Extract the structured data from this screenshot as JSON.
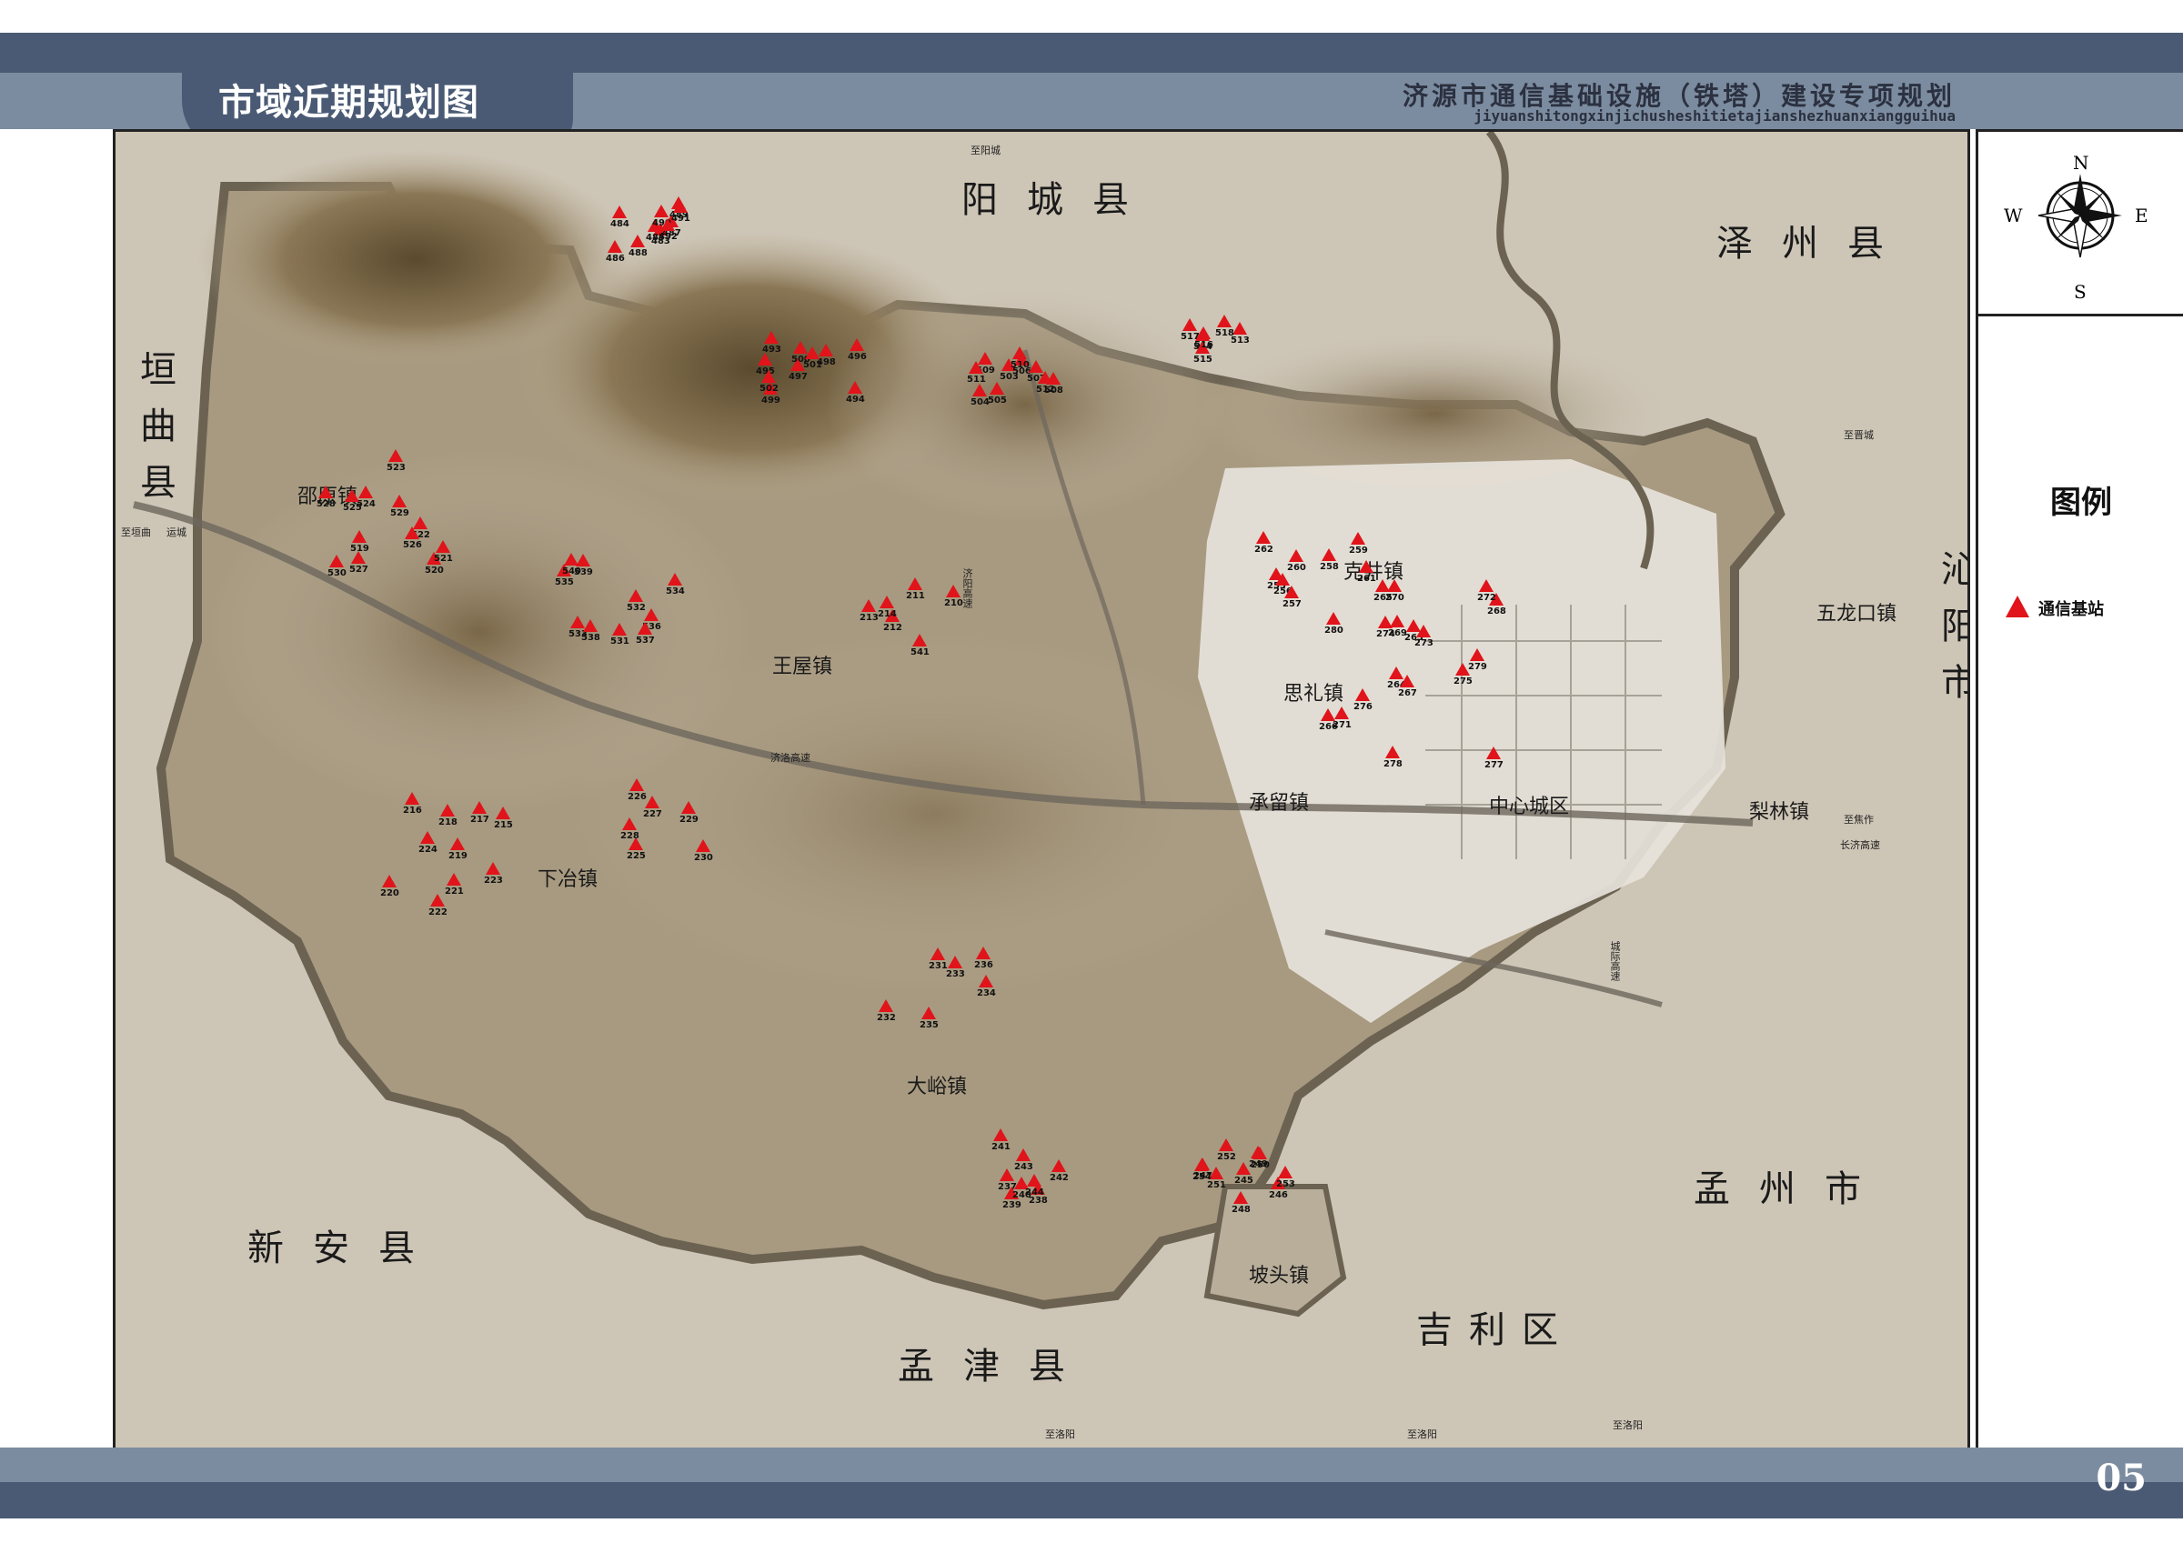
{
  "header": {
    "title": "市域近期规划图",
    "project_title": "济源市通信基础设施（铁塔）建设专项规划",
    "project_pinyin": "jiyuanshitongxinjichusheshitietajianshezhuanxiangguihua"
  },
  "footer": {
    "page_number": "05"
  },
  "compass": {
    "n": "N",
    "s": "S",
    "e": "E",
    "w": "W"
  },
  "legend": {
    "title": "图例",
    "items": [
      {
        "label": "通信基站",
        "color": "#e0141a",
        "icon": "red-triangle-icon"
      }
    ]
  },
  "map": {
    "neighbors": {
      "yangcheng": "阳城县",
      "zezhou": "泽州县",
      "yuanqu": "垣曲县",
      "qinyang": "沁阳市",
      "xinan": "新安县",
      "mengjin": "孟津县",
      "mengzhou": "孟州市",
      "jili": "吉利区"
    },
    "towns": {
      "shaoyuan": "邵原镇",
      "wangwu": "王屋镇",
      "xiaye": "下冶镇",
      "dayu": "大峪镇",
      "potou": "坡头镇",
      "kejing": "克井镇",
      "sili": "思礼镇",
      "chengliu": "承留镇",
      "center": "中心城区",
      "wulongkou": "五龙口镇",
      "liling": "梨林镇"
    },
    "roads": {
      "to_yangcheng": "至阳城",
      "to_yuncheng": "至垣曲",
      "yuncheng": "运城",
      "jiyang_highway": "济阳高速",
      "jiluo_highway": "济洛高速",
      "to_jincheng": "至晋城",
      "to_jiaozuo": "至焦作",
      "changji_highway": "长济高速",
      "to_luoyang_1": "至洛阳",
      "to_luoyang_2": "至洛阳",
      "to_luoyang_3": "至洛阳",
      "chengji_highway": "城际高速"
    },
    "stations": [
      "483",
      "484",
      "485",
      "486",
      "487",
      "488",
      "489",
      "490",
      "491",
      "492",
      "493",
      "494",
      "495",
      "496",
      "497",
      "498",
      "499",
      "500",
      "501",
      "502",
      "503",
      "504",
      "505",
      "506",
      "507",
      "508",
      "509",
      "510",
      "511",
      "512",
      "513",
      "514",
      "515",
      "516",
      "517",
      "518",
      "519",
      "520",
      "521",
      "522",
      "523",
      "524",
      "525",
      "526",
      "527",
      "528",
      "529",
      "530",
      "531",
      "532",
      "533",
      "534",
      "535",
      "536",
      "537",
      "538",
      "539",
      "540",
      "541",
      "210",
      "211",
      "212",
      "213",
      "214",
      "215",
      "216",
      "217",
      "218",
      "219",
      "220",
      "221",
      "222",
      "223",
      "224",
      "225",
      "226",
      "227",
      "228",
      "229",
      "230",
      "231",
      "232",
      "233",
      "234",
      "235",
      "236",
      "237",
      "238",
      "239",
      "240",
      "241",
      "242",
      "243",
      "244",
      "245",
      "246",
      "247",
      "248",
      "249",
      "250",
      "251",
      "252",
      "253",
      "254",
      "255",
      "256",
      "257",
      "258",
      "259",
      "260",
      "261",
      "262",
      "263",
      "264",
      "265",
      "266",
      "267",
      "268",
      "269",
      "270",
      "271",
      "272",
      "273",
      "274",
      "275",
      "276",
      "277",
      "278",
      "279",
      "280"
    ]
  }
}
